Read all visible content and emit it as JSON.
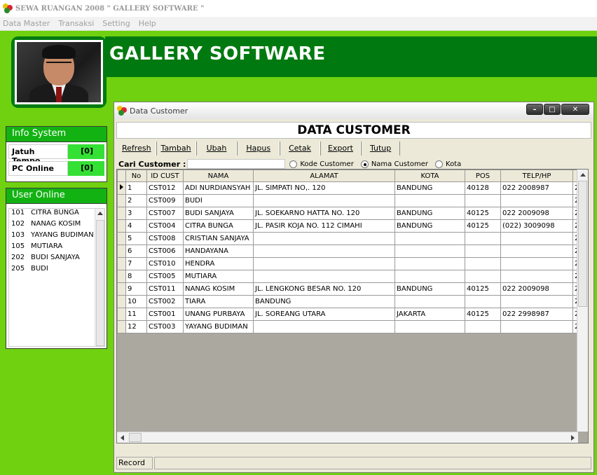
{
  "app": {
    "title": "SEWA RUANGAN 2008 \" GALLERY SOFTWARE \"",
    "brand": "GALLERY SOFTWARE"
  },
  "menu": [
    "Data Master",
    "Transaksi",
    "Setting",
    "Help"
  ],
  "info_system": {
    "header": "Info System",
    "rows": [
      {
        "label": "Jatuh Tempo",
        "value": "[0]"
      },
      {
        "label": "PC Online",
        "value": "[0]"
      }
    ]
  },
  "user_online": {
    "header": "User Online",
    "users": [
      {
        "code": "101",
        "name": "CITRA BUNGA"
      },
      {
        "code": "102",
        "name": "NANAG KOSIM"
      },
      {
        "code": "103",
        "name": "YAYANG BUDIMAN"
      },
      {
        "code": "105",
        "name": "MUTIARA"
      },
      {
        "code": "202",
        "name": "BUDI SANJAYA"
      },
      {
        "code": "205",
        "name": "BUDI"
      }
    ]
  },
  "window": {
    "title": "Data Customer",
    "form_title": "DATA CUSTOMER",
    "toolbar": [
      "Refresh",
      "Tambah",
      "Ubah",
      "Hapus",
      "Cetak",
      "Export",
      "Tutup"
    ],
    "search_label": "Cari Customer :",
    "search_value": "",
    "radio_options": [
      {
        "label": "Kode Customer",
        "checked": false
      },
      {
        "label": "Nama Customer",
        "checked": true
      },
      {
        "label": "Kota",
        "checked": false
      }
    ],
    "status_label": "Record"
  },
  "table": {
    "columns": [
      "No",
      "ID CUST",
      "NAMA",
      "ALAMAT",
      "KOTA",
      "POS",
      "TELP/HP",
      ""
    ],
    "rows": [
      [
        "1",
        "CST012",
        "ADI NURDIANSYAH",
        "JL. SIMPATI NO,. 120",
        "BANDUNG",
        "40128",
        "022 2008987",
        "2"
      ],
      [
        "2",
        "CST009",
        "BUDI",
        "",
        "",
        "",
        "",
        "2"
      ],
      [
        "3",
        "CST007",
        "BUDI SANJAYA",
        "JL. SOEKARNO HATTA NO. 120",
        "BANDUNG",
        "40125",
        "022 2009098",
        "2"
      ],
      [
        "4",
        "CST004",
        "CITRA BUNGA",
        "JL. PASIR KOJA NO. 112 CIMAHI",
        "BANDUNG",
        "40125",
        "(022) 3009098",
        "2"
      ],
      [
        "5",
        "CST008",
        "CRISTIAN SANJAYA",
        "",
        "",
        "",
        "",
        "2"
      ],
      [
        "6",
        "CST006",
        "HANDAYANA",
        "",
        "",
        "",
        "",
        "2"
      ],
      [
        "7",
        "CST010",
        "HENDRA",
        "",
        "",
        "",
        "",
        "2"
      ],
      [
        "8",
        "CST005",
        "MUTIARA",
        "",
        "",
        "",
        "",
        "2"
      ],
      [
        "9",
        "CST011",
        "NANAG KOSIM",
        "JL. LENGKONG BESAR NO. 120",
        "BANDUNG",
        "40125",
        "022 2009098",
        "2"
      ],
      [
        "10",
        "CST002",
        "TIARA",
        "BANDUNG",
        "",
        "",
        "",
        "2"
      ],
      [
        "11",
        "CST001",
        "UNANG PURBAYA",
        "JL. SOREANG UTARA",
        "JAKARTA",
        "40125",
        "022 2998987",
        "2"
      ],
      [
        "12",
        "CST003",
        "YAYANG BUDIMAN",
        "",
        "",
        "",
        "",
        "2"
      ]
    ]
  },
  "colors": {
    "green_bg": "#6fd10f",
    "dark_green": "#007a10",
    "panel_green": "#13b213",
    "value_green": "#34e034"
  }
}
